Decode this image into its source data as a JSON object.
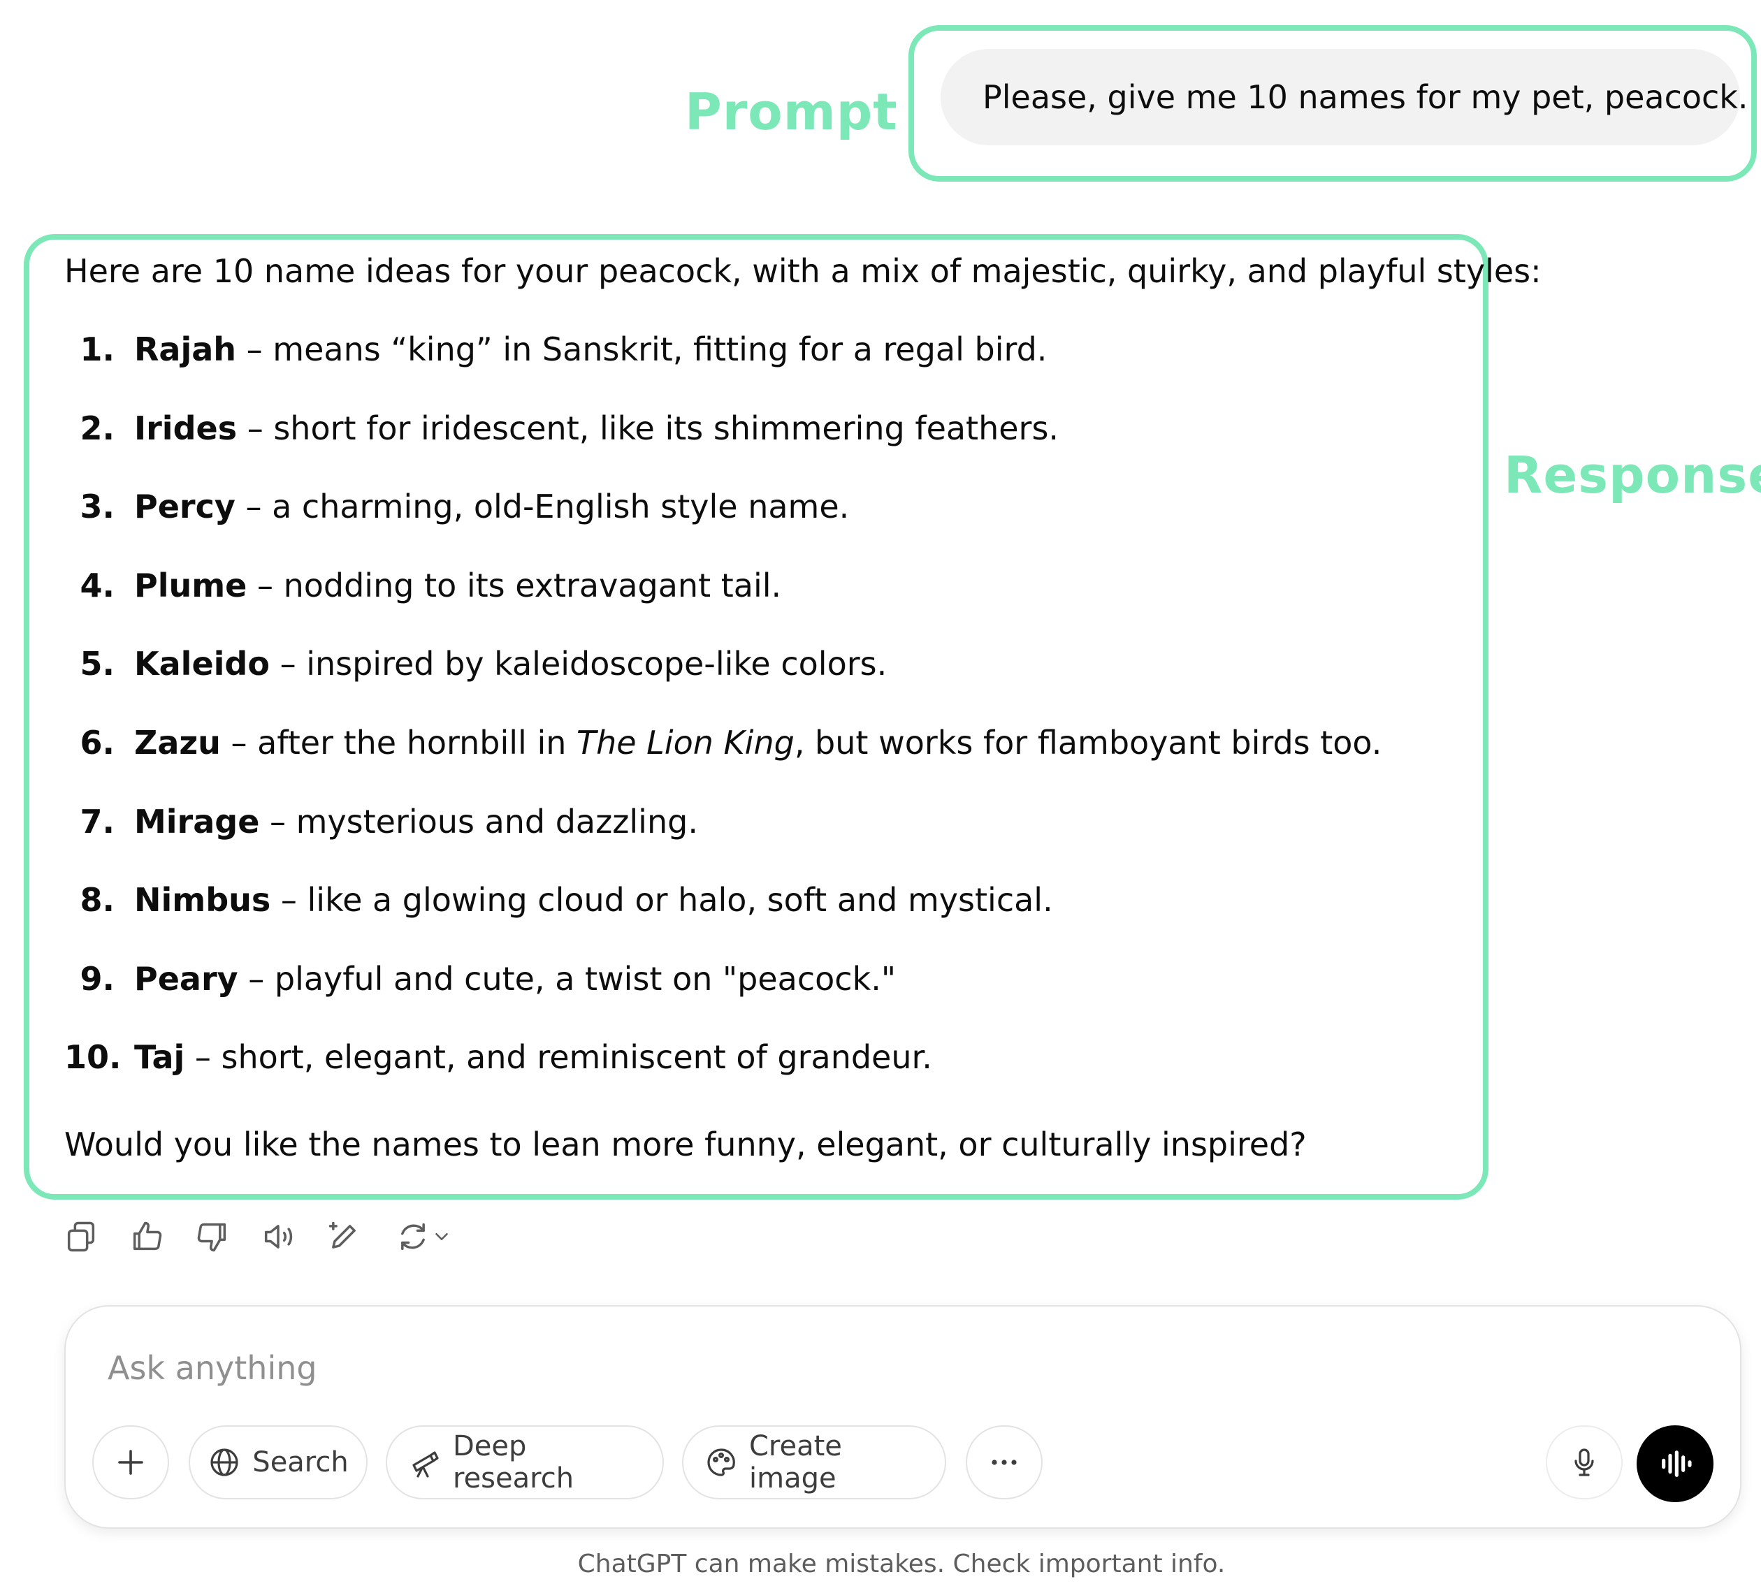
{
  "annotations": {
    "prompt_label": "Prompt",
    "response_label": "Response",
    "accent_color": "#7ce8b8"
  },
  "user_message": "Please, give me 10 names for my pet, peacock.",
  "response": {
    "intro": "Here are 10 name ideas for your peacock, with a mix of majestic, quirky, and playful styles:",
    "items": [
      {
        "num": "1.",
        "name": "Rajah",
        "desc": " – means “king” in Sanskrit, fitting for a regal bird."
      },
      {
        "num": "2.",
        "name": "Irides",
        "desc": " – short for iridescent, like its shimmering feathers."
      },
      {
        "num": "3.",
        "name": "Percy",
        "desc": " – a charming, old-English style name."
      },
      {
        "num": "4.",
        "name": "Plume",
        "desc": " – nodding to its extravagant tail."
      },
      {
        "num": "5.",
        "name": "Kaleido",
        "desc": " – inspired by kaleidoscope-like colors."
      },
      {
        "num": "6.",
        "name": "Zazu",
        "desc_before": " – after the hornbill in ",
        "desc_italic": "The Lion King",
        "desc_after": ", but works for flamboyant birds too."
      },
      {
        "num": "7.",
        "name": "Mirage",
        "desc": " – mysterious and dazzling."
      },
      {
        "num": "8.",
        "name": "Nimbus",
        "desc": " – like a glowing cloud or halo, soft and mystical."
      },
      {
        "num": "9.",
        "name": "Peary",
        "desc": " – playful and cute, a twist on \"peacock.\""
      },
      {
        "num": "10.",
        "name": "Taj",
        "desc": " – short, elegant, and reminiscent of grandeur."
      }
    ],
    "outro": "Would you like the names to lean more funny, elegant, or culturally inspired?"
  },
  "action_icons": [
    "copy-icon",
    "thumbs-up-icon",
    "thumbs-down-icon",
    "read-aloud-icon",
    "edit-icon",
    "regenerate-icon",
    "chevron-down-icon"
  ],
  "composer": {
    "placeholder": "Ask anything",
    "tools": {
      "search": "Search",
      "deep_research": "Deep research",
      "create_image": "Create image"
    }
  },
  "disclaimer": "ChatGPT can make mistakes. Check important info."
}
